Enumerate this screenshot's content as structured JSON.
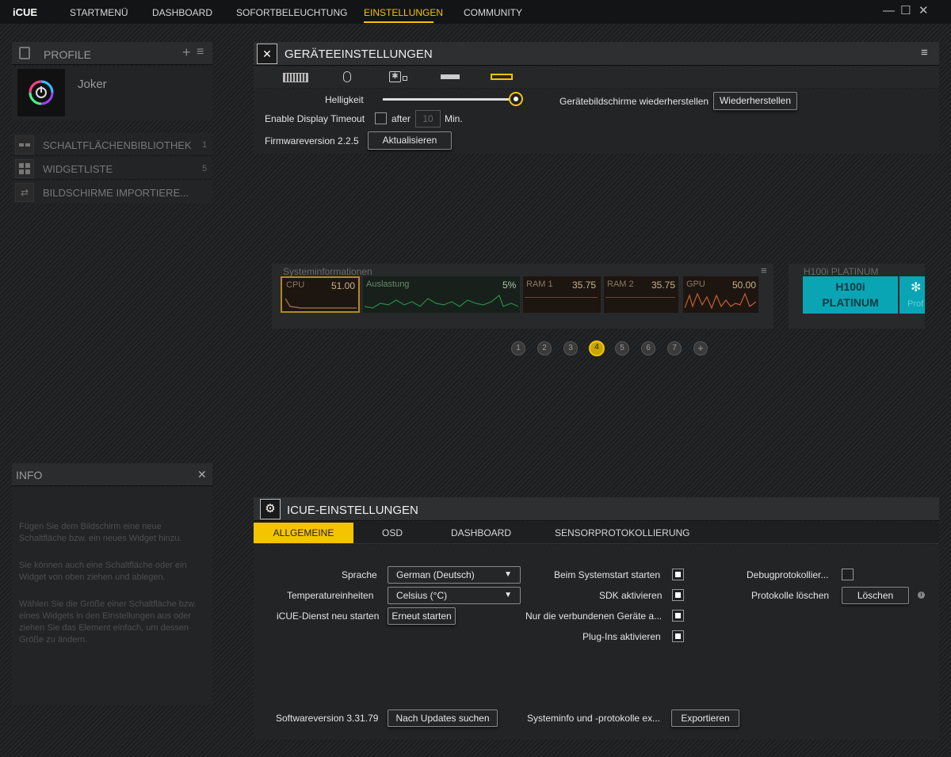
{
  "app": {
    "title": "iCUE"
  },
  "nav": {
    "items": [
      "STARTMENÜ",
      "DASHBOARD",
      "SOFORTBELEUCHTUNG",
      "EINSTELLUNGEN",
      "COMMUNITY"
    ],
    "active": "EINSTELLUNGEN"
  },
  "window": {
    "minimize": "—",
    "maximize": "☐",
    "close": "✕"
  },
  "profile": {
    "title": "PROFILE",
    "add": "+",
    "menu": "≡",
    "name": "Joker"
  },
  "library": {
    "items": [
      {
        "label": "SCHALTFLÄCHENBIBLIOTHEK",
        "count": "1"
      },
      {
        "label": "WIDGETLISTE",
        "count": "5"
      },
      {
        "label": "BILDSCHIRME IMPORTIERE..."
      }
    ]
  },
  "info": {
    "title": "INFO",
    "close": "✕",
    "paragraphs": [
      "Fügen Sie dem Bildschirm eine neue Schaltfläche bzw. ein neues Widget hinzu.",
      "Sie können auch eine Schaltfläche oder ein Widget von oben ziehen und ablegen.",
      "Wählen Sie die Größe einer Schaltfläche bzw. eines Widgets in den Einstellungen aus oder ziehen Sie das Element einfach, um dessen Größe zu ändern."
    ]
  },
  "device_settings": {
    "title": "GERÄTEEINSTELLUNGEN",
    "brightness_label": "Helligkeit",
    "brightness": 1.0,
    "restore_label": "Gerätebildschirme wiederherstellen",
    "restore_button": "Wiederherstellen",
    "display_timeout_label": "Enable Display Timeout",
    "after_label": "after",
    "timeout_value": "10",
    "minutes_label": "Min.",
    "firmware_label": "Firmwareversion 2.2.5",
    "update_button": "Aktualisieren"
  },
  "preview": {
    "sysinfo_title": "Systeminformationen",
    "cells": [
      {
        "label": "CPU",
        "value": "51.00"
      },
      {
        "label": "Auslastung",
        "value": "5%"
      },
      {
        "label": "RAM 1",
        "value": "35.75"
      },
      {
        "label": "RAM 2",
        "value": "35.75"
      },
      {
        "label": "GPU",
        "value": "50.00"
      }
    ],
    "device_title": "H100i PLATINUM",
    "device_tile_line1": "H100i",
    "device_tile_line2": "PLATINUM",
    "device_tile_partial": "Prof",
    "pages": [
      "1",
      "2",
      "3",
      "4",
      "5",
      "6",
      "7",
      "+"
    ],
    "active_page": "4"
  },
  "icue_settings": {
    "title": "ICUE-EINSTELLUNGEN",
    "tabs": [
      "ALLGEMEINE",
      "OSD",
      "DASHBOARD",
      "SENSORPROTOKOLLIERUNG"
    ],
    "active_tab": "ALLGEMEINE",
    "language_label": "Sprache",
    "language_value": "German (Deutsch)",
    "temp_label": "Temperatureinheiten",
    "temp_value": "Celsius (°C)",
    "restart_label": "iCUE-Dienst neu starten",
    "restart_button": "Erneut starten",
    "startup_label": "Beim Systemstart starten",
    "sdk_label": "SDK aktivieren",
    "connected_only_label": "Nur die verbundenen Geräte a...",
    "plugins_label": "Plug-Ins aktivieren",
    "debug_label": "Debugprotokollier...",
    "delete_logs_label": "Protokolle löschen",
    "delete_button": "Löschen",
    "software_label": "Softwareversion 3.31.79",
    "check_updates_button": "Nach Updates suchen",
    "export_label": "Systeminfo und -protokolle ex...",
    "export_button": "Exportieren"
  },
  "colors": {
    "accent": "#f5c400",
    "cyan": "#0aa5b5"
  }
}
